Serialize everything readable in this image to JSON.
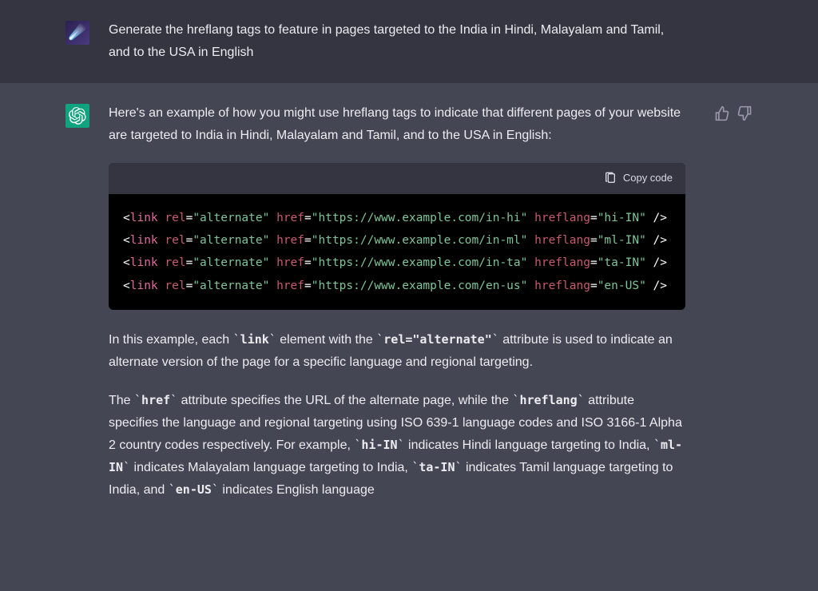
{
  "user": {
    "prompt": "Generate the hreflang tags to feature in pages targeted to the India in Hindi, Malayalam and Tamil, and to the USA in English"
  },
  "assistant": {
    "intro": "Here's an example of how you might use hreflang tags to indicate that different pages of your website are targeted to India in Hindi, Malayalam and Tamil, and to the USA in English:",
    "copy_label": "Copy code",
    "code_lines": [
      {
        "href": "https://www.example.com/in-hi",
        "hreflang": "hi-IN"
      },
      {
        "href": "https://www.example.com/in-ml",
        "hreflang": "ml-IN"
      },
      {
        "href": "https://www.example.com/in-ta",
        "hreflang": "ta-IN"
      },
      {
        "href": "https://www.example.com/en-us",
        "hreflang": "en-US"
      }
    ],
    "para2_pre": "In this example, each ",
    "para2_code1": "link",
    "para2_mid": " element with the ",
    "para2_code2": "rel=\"alternate\"",
    "para2_post": " attribute is used to indicate an alternate version of the page for a specific language and regional targeting.",
    "para3_pre": "The ",
    "para3_code1": "href",
    "para3_mid1": " attribute specifies the URL of the alternate page, while the ",
    "para3_code2": "hreflang",
    "para3_mid2": " attribute specifies the language and regional targeting using ISO 639-1 language codes and ISO 3166-1 Alpha 2 country codes respectively. For example, ",
    "para3_code3": "hi-IN",
    "para3_mid3": " indicates Hindi language targeting to India, ",
    "para3_code4": "ml-IN",
    "para3_mid4": " indicates Malayalam language targeting to India, ",
    "para3_code5": "ta-IN",
    "para3_mid5": " indicates Tamil language targeting to India, and ",
    "para3_code6": "en-US",
    "para3_mid6": " indicates English language"
  }
}
